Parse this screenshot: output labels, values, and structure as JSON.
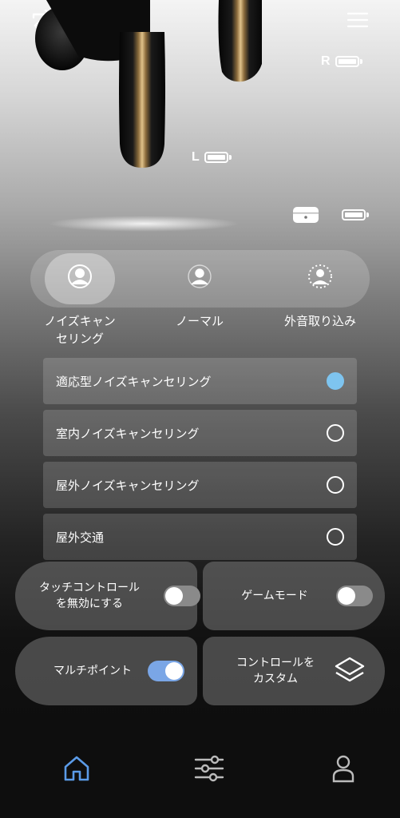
{
  "header": {
    "left_icon": "swap-icon",
    "right_icon": "hamburger-menu-icon"
  },
  "battery": {
    "right_label": "R",
    "left_label": "L",
    "case_icon": "charging-case-icon",
    "level_right": 1.0,
    "level_left": 1.0,
    "level_case": 1.0
  },
  "modes": {
    "items": [
      {
        "label": "ノイズキャン\nセリング",
        "icon": "noise-cancelling-person-icon",
        "active": true
      },
      {
        "label": "ノーマル",
        "icon": "normal-person-icon",
        "active": false
      },
      {
        "label": "外音取り込み",
        "icon": "ambient-person-icon",
        "active": false
      }
    ]
  },
  "options": [
    {
      "label": "適応型ノイズキャンセリング",
      "selected": true
    },
    {
      "label": "室内ノイズキャンセリング",
      "selected": false
    },
    {
      "label": "屋外ノイズキャンセリング",
      "selected": false
    },
    {
      "label": "屋外交通",
      "selected": false
    }
  ],
  "cards": {
    "touch_control": {
      "label": "タッチコントロール\nを無効にする",
      "on": false
    },
    "game_mode": {
      "label": "ゲームモード",
      "on": false
    },
    "multipoint": {
      "label": "マルチポイント",
      "on": true
    },
    "custom_control": {
      "label": "コントロールを\nカスタム",
      "icon": "layers-icon"
    }
  },
  "nav": {
    "items": [
      {
        "icon": "home-icon",
        "active": true
      },
      {
        "icon": "equalizer-icon",
        "active": false
      },
      {
        "icon": "profile-icon",
        "active": false
      }
    ]
  },
  "colors": {
    "accent_blue": "#7ec4ef",
    "toggle_on": "#7aa6e6",
    "nav_active": "#5b9be8"
  }
}
